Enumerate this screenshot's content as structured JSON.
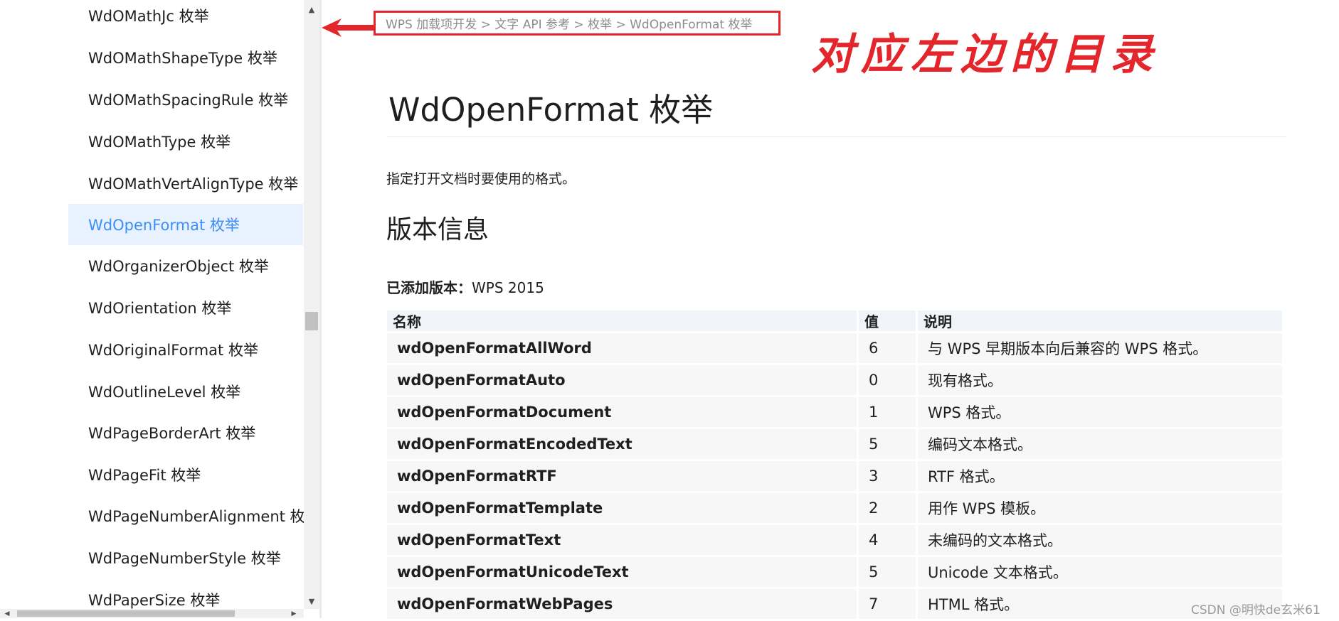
{
  "sidebar": {
    "items": [
      {
        "label": "WdOMathJc 枚举",
        "active": false
      },
      {
        "label": "WdOMathShapeType 枚举",
        "active": false
      },
      {
        "label": "WdOMathSpacingRule 枚举",
        "active": false
      },
      {
        "label": "WdOMathType 枚举",
        "active": false
      },
      {
        "label": "WdOMathVertAlignType 枚举",
        "active": false
      },
      {
        "label": "WdOpenFormat 枚举",
        "active": true
      },
      {
        "label": "WdOrganizerObject 枚举",
        "active": false
      },
      {
        "label": "WdOrientation 枚举",
        "active": false
      },
      {
        "label": "WdOriginalFormat 枚举",
        "active": false
      },
      {
        "label": "WdOutlineLevel 枚举",
        "active": false
      },
      {
        "label": "WdPageBorderArt 枚举",
        "active": false
      },
      {
        "label": "WdPageFit 枚举",
        "active": false
      },
      {
        "label": "WdPageNumberAlignment 枚举",
        "active": false
      },
      {
        "label": "WdPageNumberStyle 枚举",
        "active": false
      },
      {
        "label": "WdPaperSize 枚举",
        "active": false
      }
    ]
  },
  "breadcrumb": "WPS 加载项开发 > 文字 API 参考 > 枚举 > WdOpenFormat 枚举",
  "annotation": "对应左边的目录",
  "page": {
    "title": "WdOpenFormat 枚举",
    "description": "指定打开文档时要使用的格式。",
    "version_heading": "版本信息",
    "version_label": "已添加版本：",
    "version_value": "WPS 2015"
  },
  "table": {
    "headers": [
      "名称",
      "值",
      "说明"
    ],
    "rows": [
      [
        "wdOpenFormatAllWord",
        "6",
        "与 WPS 早期版本向后兼容的 WPS 格式。"
      ],
      [
        "wdOpenFormatAuto",
        "0",
        "现有格式。"
      ],
      [
        "wdOpenFormatDocument",
        "1",
        "WPS 格式。"
      ],
      [
        "wdOpenFormatEncodedText",
        "5",
        "编码文本格式。"
      ],
      [
        "wdOpenFormatRTF",
        "3",
        "RTF 格式。"
      ],
      [
        "wdOpenFormatTemplate",
        "2",
        "用作 WPS 模板。"
      ],
      [
        "wdOpenFormatText",
        "4",
        "未编码的文本格式。"
      ],
      [
        "wdOpenFormatUnicodeText",
        "5",
        "Unicode 文本格式。"
      ],
      [
        "wdOpenFormatWebPages",
        "7",
        "HTML 格式。"
      ]
    ]
  },
  "watermark": "CSDN @明快de玄米61",
  "colors": {
    "accent": "#3e8ef7",
    "annotation_red": "#e3262b",
    "active_bg": "#e8f1fe"
  },
  "icons": {
    "scroll_up": "triangle-up-icon",
    "scroll_down": "triangle-down-icon",
    "scroll_left": "triangle-left-icon",
    "scroll_right": "triangle-right-icon",
    "annotation_arrow": "arrow-left-icon"
  }
}
